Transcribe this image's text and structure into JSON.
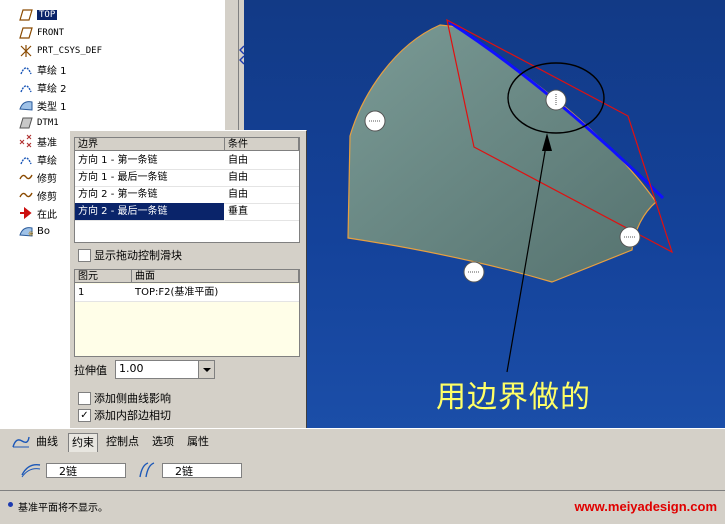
{
  "model_tree": {
    "items": [
      {
        "label": "TOP",
        "icon": "datum-plane-icon",
        "selected": true
      },
      {
        "label": "FRONT",
        "icon": "datum-plane-icon"
      },
      {
        "label": "PRT_CSYS_DEF",
        "icon": "coordinate-system-icon"
      },
      {
        "label": "草绘 1",
        "icon": "sketch-icon"
      },
      {
        "label": "草绘 2",
        "icon": "sketch-icon"
      },
      {
        "label": "类型 1",
        "icon": "surface-icon"
      },
      {
        "label": "DTM1",
        "icon": "datum-plane-icon"
      },
      {
        "label": "基准",
        "icon": "datum-point-icon"
      },
      {
        "label": "草绘",
        "icon": "sketch-icon"
      },
      {
        "label": "修剪",
        "icon": "trim-icon"
      },
      {
        "label": "修剪",
        "icon": "trim-icon"
      },
      {
        "label": "在此",
        "icon": "insert-here-icon"
      },
      {
        "label": "Bo",
        "icon": "boundary-blend-icon"
      }
    ]
  },
  "constraints_panel": {
    "header": {
      "boundary": "边界",
      "condition": "条件"
    },
    "rows": [
      {
        "boundary": "方向 1 - 第一条链",
        "condition": "自由"
      },
      {
        "boundary": "方向 1 - 最后一条链",
        "condition": "自由"
      },
      {
        "boundary": "方向 2 - 第一条链",
        "condition": "自由"
      },
      {
        "boundary": "方向 2 - 最后一条链",
        "condition": "垂直",
        "selected": true
      }
    ],
    "show_drag_handles_label": "显示拖动控制滑块",
    "show_drag_handles_checked": false,
    "ref_header": {
      "element": "图元",
      "surface": "曲面"
    },
    "ref_rows": [
      {
        "element": "1",
        "surface": "TOP:F2(基准平面)"
      }
    ],
    "stretch_label": "拉伸值",
    "stretch_value": "1.00",
    "add_side_curve_label": "添加侧曲线影响",
    "add_side_curve_checked": false,
    "add_inner_edge_label": "添加内部边相切",
    "add_inner_edge_checked": true
  },
  "viewport": {
    "annotation": "用边界做的"
  },
  "dashboard": {
    "tabs": [
      "曲线",
      "约束",
      "控制点",
      "选项",
      "属性"
    ],
    "active_tab": "约束",
    "dir1_value": "2链",
    "dir2_value": "2链"
  },
  "status": {
    "message": "基准平面将不显示。",
    "watermark": "www.meiyadesign.com"
  },
  "colors": {
    "viewport_bg": "#14429a",
    "surface_fill": "#6f8f8b",
    "edge_highlight": "#0000ff",
    "datum_plane": "#e01010",
    "annotation_text": "#ffff66",
    "watermark": "#e00000",
    "selection": "#0a246a"
  }
}
